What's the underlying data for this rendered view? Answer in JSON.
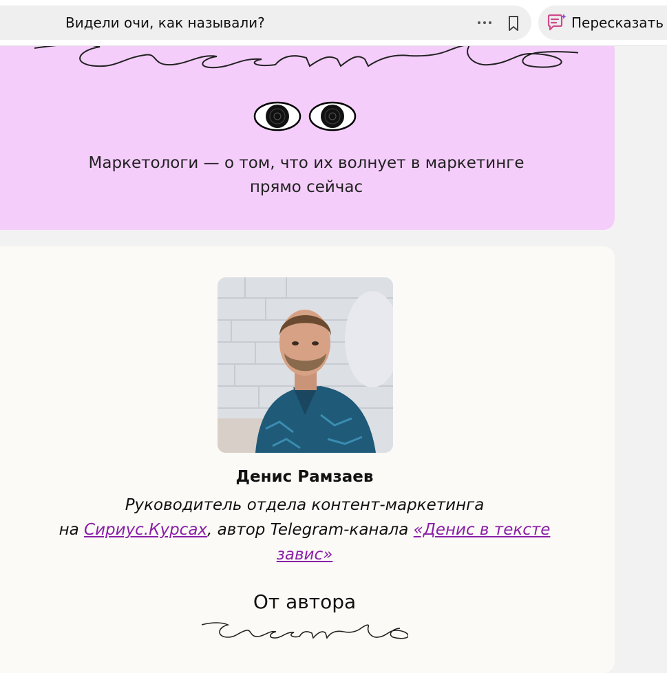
{
  "topbar": {
    "title": "Видели очи, как называли?",
    "more_icon": "more-dots-icon",
    "bookmark_icon": "bookmark-icon",
    "retell_icon": "retell-summary-icon",
    "retell_label": "Пересказать"
  },
  "promo": {
    "logo_word": "честно",
    "text_line1": "Маркетологи — о том, что их волнует в маркетинге",
    "text_line2": "прямо сейчас",
    "background": "#f4cdfa"
  },
  "author": {
    "name": "Денис Рамзаев",
    "role_line1": "Руководитель отдела контент-маркетинга",
    "role_prefix": "на ",
    "company_link": "Сириус.Курсах",
    "role_middle": ", автор Telegram-канала ",
    "channel_link": "«Денис в тексте завис»",
    "link_color": "#8a1fa8"
  },
  "section": {
    "heading": "От автора",
    "logo_word": "честно"
  }
}
